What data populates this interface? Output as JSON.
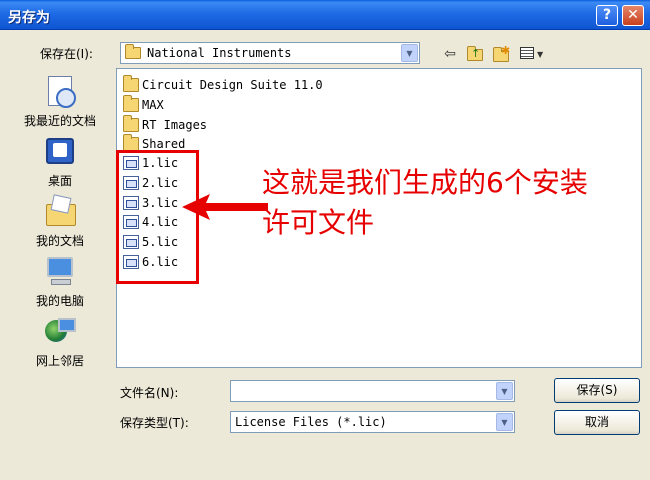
{
  "window": {
    "title": "另存为",
    "help_glyph": "?",
    "close_glyph": "✕"
  },
  "save_in": {
    "label": "保存在(I):",
    "value": "National Instruments"
  },
  "toolbar": {
    "icons": [
      "back-arrow-icon",
      "up-folder-icon",
      "new-folder-icon",
      "view-menu-icon"
    ]
  },
  "places": [
    {
      "label": "我最近的文档",
      "icon": "recent-documents-icon"
    },
    {
      "label": "桌面",
      "icon": "desktop-icon"
    },
    {
      "label": "我的文档",
      "icon": "my-documents-icon"
    },
    {
      "label": "我的电脑",
      "icon": "my-computer-icon"
    },
    {
      "label": "网上邻居",
      "icon": "network-places-icon"
    }
  ],
  "files": [
    {
      "name": "Circuit Design Suite 11.0",
      "type": "folder"
    },
    {
      "name": "MAX",
      "type": "folder"
    },
    {
      "name": "RT Images",
      "type": "folder"
    },
    {
      "name": "Shared",
      "type": "folder"
    },
    {
      "name": "1.lic",
      "type": "license"
    },
    {
      "name": "2.lic",
      "type": "license"
    },
    {
      "name": "3.lic",
      "type": "license"
    },
    {
      "name": "4.lic",
      "type": "license"
    },
    {
      "name": "5.lic",
      "type": "license"
    },
    {
      "name": "6.lic",
      "type": "license"
    }
  ],
  "annotation": {
    "line1": "这就是我们生成的6个安装",
    "line2": "许可文件",
    "color": "#e60000"
  },
  "filename": {
    "label": "文件名(N):",
    "value": ""
  },
  "filetype": {
    "label": "保存类型(T):",
    "value": "License Files (*.lic)"
  },
  "buttons": {
    "save": "保存(S)",
    "cancel": "取消"
  }
}
